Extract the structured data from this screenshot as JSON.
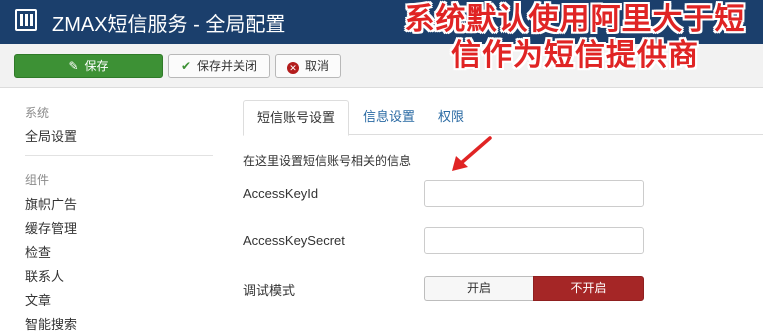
{
  "header": {
    "title": "ZMAX短信服务 - 全局配置",
    "icon": "joomla-grid-icon"
  },
  "toolbar": {
    "save_label": "保存",
    "save_close_label": "保存并关闭",
    "cancel_label": "取消",
    "save_icon": "edit-icon",
    "save_close_icon": "check-icon",
    "cancel_icon": "cancel-circle-icon",
    "accent_color": "#3d9135"
  },
  "sidebar": {
    "system_heading": "系统",
    "system_items": [
      {
        "label": "全局设置"
      }
    ],
    "components_heading": "组件",
    "component_items": [
      {
        "label": "旗帜广告"
      },
      {
        "label": "缓存管理"
      },
      {
        "label": "检查"
      },
      {
        "label": "联系人"
      },
      {
        "label": "文章"
      },
      {
        "label": "智能搜索"
      }
    ]
  },
  "tabs": [
    {
      "label": "短信账号设置",
      "active": true
    },
    {
      "label": "信息设置",
      "active": false
    },
    {
      "label": "权限",
      "active": false
    }
  ],
  "form": {
    "description": "在这里设置短信账号相关的信息",
    "fields": [
      {
        "label": "AccessKeyId",
        "value": ""
      },
      {
        "label": "AccessKeySecret",
        "value": ""
      }
    ],
    "debug_label": "调试模式",
    "debug_on_label": "开启",
    "debug_off_label": "不开启",
    "debug_selected": "不开启",
    "debug_off_color": "#a52626"
  },
  "annotation": {
    "text": "系统默认使用阿里大于短信作为短信提供商",
    "color": "#e02424"
  }
}
